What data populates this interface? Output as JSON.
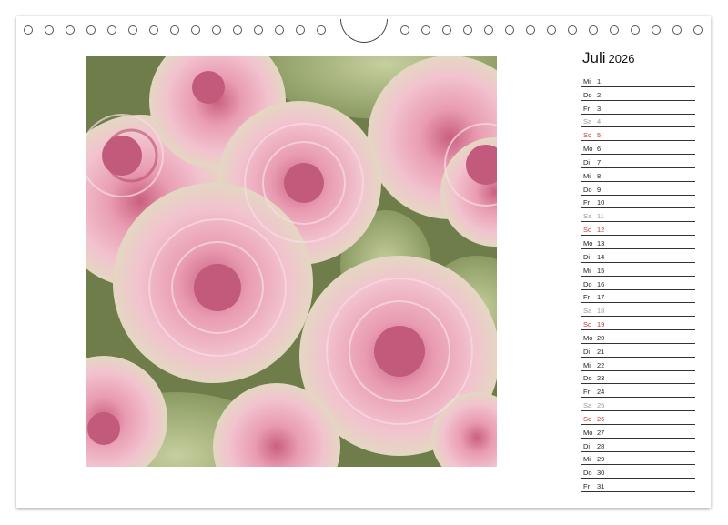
{
  "calendar": {
    "month": "Juli",
    "year": "2026",
    "days": [
      {
        "wd": "Mi",
        "d": "1",
        "type": "weekday"
      },
      {
        "wd": "Do",
        "d": "2",
        "type": "weekday"
      },
      {
        "wd": "Fr",
        "d": "3",
        "type": "weekday"
      },
      {
        "wd": "Sa",
        "d": "4",
        "type": "sat"
      },
      {
        "wd": "So",
        "d": "5",
        "type": "sun"
      },
      {
        "wd": "Mo",
        "d": "6",
        "type": "weekday"
      },
      {
        "wd": "Di",
        "d": "7",
        "type": "weekday"
      },
      {
        "wd": "Mi",
        "d": "8",
        "type": "weekday"
      },
      {
        "wd": "Do",
        "d": "9",
        "type": "weekday"
      },
      {
        "wd": "Fr",
        "d": "10",
        "type": "weekday"
      },
      {
        "wd": "Sa",
        "d": "11",
        "type": "sat"
      },
      {
        "wd": "So",
        "d": "12",
        "type": "sun"
      },
      {
        "wd": "Mo",
        "d": "13",
        "type": "weekday"
      },
      {
        "wd": "Di",
        "d": "14",
        "type": "weekday"
      },
      {
        "wd": "Mi",
        "d": "15",
        "type": "weekday"
      },
      {
        "wd": "Do",
        "d": "16",
        "type": "weekday"
      },
      {
        "wd": "Fr",
        "d": "17",
        "type": "weekday"
      },
      {
        "wd": "Sa",
        "d": "18",
        "type": "sat"
      },
      {
        "wd": "So",
        "d": "19",
        "type": "sun"
      },
      {
        "wd": "Mo",
        "d": "20",
        "type": "weekday"
      },
      {
        "wd": "Di",
        "d": "21",
        "type": "weekday"
      },
      {
        "wd": "Mi",
        "d": "22",
        "type": "weekday"
      },
      {
        "wd": "Do",
        "d": "23",
        "type": "weekday"
      },
      {
        "wd": "Fr",
        "d": "24",
        "type": "weekday"
      },
      {
        "wd": "Sa",
        "d": "25",
        "type": "sat"
      },
      {
        "wd": "So",
        "d": "26",
        "type": "sun"
      },
      {
        "wd": "Mo",
        "d": "27",
        "type": "weekday"
      },
      {
        "wd": "Di",
        "d": "28",
        "type": "weekday"
      },
      {
        "wd": "Mi",
        "d": "29",
        "type": "weekday"
      },
      {
        "wd": "Do",
        "d": "30",
        "type": "weekday"
      },
      {
        "wd": "Fr",
        "d": "31",
        "type": "weekday"
      }
    ]
  },
  "colors": {
    "sunday": "#c0392b",
    "saturday": "#999999",
    "weekday": "#222222",
    "rose_pink": "#e8a4b8",
    "leaf_green": "#a9b98a"
  }
}
